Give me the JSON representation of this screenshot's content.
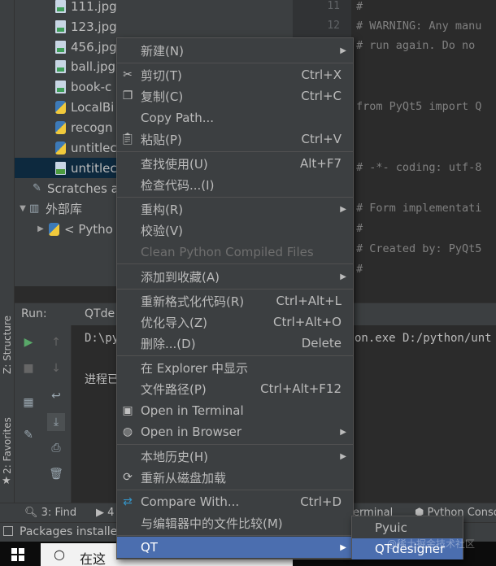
{
  "left_strip": {
    "structure": "Z: Structure",
    "favorites": "2: Favorites"
  },
  "project_tree": {
    "items": [
      {
        "label": "111.jpg",
        "icon": "jpg-file-icon"
      },
      {
        "label": "123.jpg",
        "icon": "jpg-file-icon"
      },
      {
        "label": "456.jpg",
        "icon": "jpg-file-icon"
      },
      {
        "label": "ball.jpg",
        "icon": "jpg-file-icon"
      },
      {
        "label": "book-c",
        "icon": "jpg-file-icon"
      },
      {
        "label": "LocalBi",
        "icon": "python-file-icon"
      },
      {
        "label": "recogn",
        "icon": "python-file-icon"
      },
      {
        "label": "untitlec",
        "icon": "python-file-icon"
      },
      {
        "label": "untitlec",
        "icon": "ui-file-icon"
      }
    ],
    "scratches": "Scratches a",
    "external_libs": "外部库",
    "python_sdk": "< Pytho"
  },
  "editor": {
    "gutter": [
      "11",
      "12"
    ],
    "lines": [
      "#",
      "# WARNING: Any manu",
      "# run again.  Do no",
      "",
      "from PyQt5 import Q",
      "",
      "",
      "# -*- coding: utf-8",
      "",
      "# Form implementati",
      "#",
      "# Created by: PyQt5",
      "#"
    ]
  },
  "run_panel": {
    "title": "Run:",
    "tab": "QTde",
    "console_line1_left": "D:\\py",
    "console_line1_right": "on.exe D:/python/unt",
    "console_line2": "进程已"
  },
  "bottom_tools": {
    "find": "3: Find",
    "run_num": "4",
    "terminal": "erminal",
    "python_console": "Python Conso"
  },
  "status": {
    "text": "Packages installe"
  },
  "taskbar": {
    "search_text": "在这"
  },
  "context_menu": {
    "new": {
      "label": "新建(N)"
    },
    "cut": {
      "label": "剪切(T)",
      "shortcut": "Ctrl+X"
    },
    "copy": {
      "label": "复制(C)",
      "shortcut": "Ctrl+C"
    },
    "copy_path": {
      "label": "Copy Path..."
    },
    "paste": {
      "label": "粘贴(P)",
      "shortcut": "Ctrl+V"
    },
    "find_usages": {
      "label": "查找使用(U)",
      "shortcut": "Alt+F7"
    },
    "inspect": {
      "label": "检查代码...(I)"
    },
    "refactor": {
      "label": "重构(R)"
    },
    "verify": {
      "label": "校验(V)"
    },
    "clean_python": {
      "label": "Clean Python Compiled Files"
    },
    "add_favorites": {
      "label": "添加到收藏(A)"
    },
    "reformat": {
      "label": "重新格式化代码(R)",
      "shortcut": "Ctrl+Alt+L"
    },
    "optimize_imports": {
      "label": "优化导入(Z)",
      "shortcut": "Ctrl+Alt+O"
    },
    "delete": {
      "label": "删除...(D)",
      "shortcut": "Delete"
    },
    "show_explorer": {
      "label": "在 Explorer 中显示"
    },
    "file_path": {
      "label": "文件路径(P)",
      "shortcut": "Ctrl+Alt+F12"
    },
    "open_terminal": {
      "label": "Open in Terminal"
    },
    "open_browser": {
      "label": "Open in Browser"
    },
    "local_history": {
      "label": "本地历史(H)"
    },
    "reload": {
      "label": "重新从磁盘加载"
    },
    "compare_with": {
      "label": "Compare With...",
      "shortcut": "Ctrl+D"
    },
    "compare_editor": {
      "label": "与编辑器中的文件比较(M)"
    },
    "qt": {
      "label": "QT"
    }
  },
  "submenu": {
    "pyuic": "Pyuic",
    "qtdesigner": "QTdesigner"
  },
  "watermark": "@稀土掘金技术社区",
  "colors": {
    "menu_bg": "#3c3f41",
    "highlight": "#4b6eaf",
    "editor_bg": "#2b2b2b",
    "selection": "#0d293e"
  }
}
